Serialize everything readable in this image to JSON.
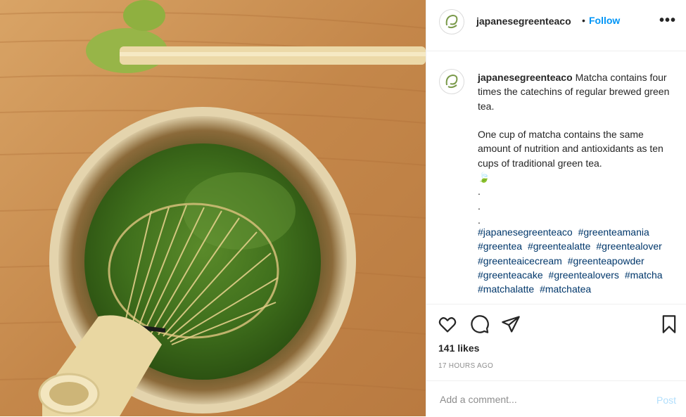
{
  "post": {
    "image_alt": "Matcha bowl with bamboo whisk and green tea powder on wooden table",
    "colors": {
      "wood": "#c98f4f",
      "matcha": "#3c6a1c",
      "link": "#00376b",
      "follow": "#0095f6"
    }
  },
  "header": {
    "username": "japanesegreenteaco",
    "separator": "•",
    "follow_label": "Follow",
    "more_icon": "more-options-icon",
    "more_label": "•••"
  },
  "caption": {
    "username": "japanesegreenteaco",
    "text": "Matcha contains four times the catechins of regular brewed green tea.\n\nOne cup of matcha contains the same amount of nutrition and antioxidants as ten cups of traditional green tea.\n🍃\n.\n.\n.",
    "hashtags": [
      "#japanesegreenteaco",
      "#greenteamania",
      "#greentea",
      "#greentealatte",
      "#greentealover",
      "#greenteaicecream",
      "#greenteapowder",
      "#greenteacake",
      "#greentealovers",
      "#matcha",
      "#matchalatte",
      "#matchatea"
    ]
  },
  "actions": {
    "like_icon": "heart-icon",
    "comment_icon": "comment-icon",
    "share_icon": "share-icon",
    "save_icon": "bookmark-icon"
  },
  "stats": {
    "likes": "141 likes",
    "timestamp": "17 HOURS AGO"
  },
  "comment_box": {
    "placeholder": "Add a comment...",
    "post_label": "Post"
  }
}
